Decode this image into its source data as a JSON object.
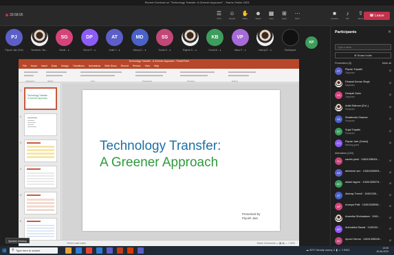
{
  "teams": {
    "window_title": "Recent Overload on \"Technology Transfer: A Greener Approach\" - Teams Online 2023",
    "timer": "33:58:05",
    "tools": [
      {
        "icon": "chat-icon",
        "glyph": "☰",
        "label": "Chat"
      },
      {
        "icon": "people-icon",
        "glyph": "☺",
        "label": "People"
      },
      {
        "icon": "raise-hand-icon",
        "glyph": "✋",
        "label": "Raise"
      },
      {
        "icon": "react-icon",
        "glyph": "☻",
        "label": "React"
      },
      {
        "icon": "view-icon",
        "glyph": "▦",
        "label": "View"
      },
      {
        "icon": "apps-icon",
        "glyph": "⊞",
        "label": "Apps"
      },
      {
        "icon": "more-icon",
        "glyph": "⋯",
        "label": "More"
      }
    ],
    "controls": [
      {
        "icon": "camera-icon",
        "glyph": "■",
        "label": "Camera"
      },
      {
        "icon": "mic-icon",
        "glyph": "♪",
        "label": "Mic"
      },
      {
        "icon": "share-icon",
        "glyph": "⇪",
        "label": "Share"
      }
    ],
    "leave_label": "Leave"
  },
  "participants_strip": [
    {
      "initials": "PJ",
      "name": "Piyush Jain (Ext)",
      "color": "#5b5fc7"
    },
    {
      "initials": "",
      "name": "Yeshveer, Ma...",
      "color": "#e8e8e8",
      "photo": true
    },
    {
      "initials": "SG",
      "name": "Sumit... ♦",
      "color": "#d6437a"
    },
    {
      "initials": "DP",
      "name": "Dhruv P... ♦",
      "color": "#8b5cf6"
    },
    {
      "initials": "AT",
      "name": "Ankit T... ♦",
      "color": "#5b5fc7"
    },
    {
      "initials": "MD",
      "name": "Manoj D... ♦",
      "color": "#4a62c9"
    },
    {
      "initials": "SS",
      "name": "Sonia S... ♦",
      "color": "#c24778"
    },
    {
      "initials": "",
      "name": "Rajesh K... ♦",
      "color": "#e8e8e8",
      "photo": true
    },
    {
      "initials": "KB",
      "name": "Kunal B... ♦",
      "color": "#3c9d5d"
    },
    {
      "initials": "VP",
      "name": "Vikas P... ♦",
      "color": "#a66bd6"
    },
    {
      "initials": "",
      "name": "Neeraj P... ♦",
      "color": "#e8e8e8",
      "photo": true
    },
    {
      "initials": "",
      "name": "Participant",
      "color": "#111111",
      "dark": true
    }
  ],
  "side_tile": {
    "initials": "KP",
    "color": "#3c9d5d"
  },
  "powerpoint": {
    "title": "Technology Transfer - A Greener Approach - PowerPoint",
    "tabs": [
      "File",
      "Home",
      "Insert",
      "Draw",
      "Design",
      "Transitions",
      "Animations",
      "Slide Show",
      "Record",
      "Review",
      "View",
      "Help"
    ],
    "ribbon_groups": [
      "Clipboard",
      "Slides",
      "Font",
      "Paragraph",
      "Drawing",
      "Editing"
    ],
    "thumb_title_l1": "Technology Transfer:",
    "thumb_title_l2": "A Greener Approach",
    "slide_title_l1": "Technology Transfer:",
    "slide_title_l2": "A Greener Approach",
    "presented_by": "Presented by",
    "presenter": "Piyush Jain",
    "status_left": "Click to add notes",
    "status_right": "Notes   Comments   ▭ ▦ ▤   — + 62%"
  },
  "panel": {
    "title": "Participants",
    "search_placeholder": "Type a name",
    "share_label": "Share invite",
    "presenters_label": "Presenters (8)",
    "mute_all": "Mute all",
    "attendees_label": "Attendees (120)",
    "presenters": [
      {
        "initials": "PT",
        "name": "Piyush Tripathi",
        "role": "Organizer",
        "color": "#5b5fc7"
      },
      {
        "initials": "",
        "name": "Dhawal Kumar Singh",
        "role": "Organizer",
        "color": "#e8e8e8",
        "photo": true
      },
      {
        "initials": "DS",
        "name": "Deepak Sahu",
        "role": "Organizer",
        "color": "#d6437a"
      },
      {
        "initials": "",
        "name": "Ankit Rathore (Ext..)",
        "role": "Presenter",
        "color": "#e8e8e8",
        "photo": true
      },
      {
        "initials": "SS",
        "name": "Shailendra Sharma",
        "role": "Presenter",
        "color": "#4a62c9"
      },
      {
        "initials": "ST",
        "name": "Sujal Tripathi",
        "role": "Presenter",
        "color": "#3c9d5d"
      },
      {
        "initials": "PJ",
        "name": "Piyush Jain (Guest)",
        "role": "Meeting guest",
        "color": "#8b5cf6"
      }
    ],
    "attendees": [
      {
        "initials": "SJ",
        "name": "sachin joshi · 1345132B001...",
        "color": "#c24778"
      },
      {
        "initials": "AS",
        "name": "abhishek sen · 1345132B003...",
        "color": "#5b5fc7"
      },
      {
        "initials": "AG",
        "name": "akash tagore · 1345132B078...",
        "color": "#3c9d5d"
      },
      {
        "initials": "AT",
        "name": "Akshay Trivedi · 13451326...",
        "color": "#4a62c9"
      },
      {
        "initials": "AP",
        "name": "Ananya Patil · 1345132B056...",
        "color": "#d6437a"
      },
      {
        "initials": "",
        "name": "Anamika Shrivastava · 1345...",
        "color": "#e8e8e8",
        "photo": true
      },
      {
        "initials": "AR",
        "name": "Aniruddha Rawat · 1345132...",
        "color": "#8b5cf6"
      },
      {
        "initials": "AV",
        "name": "Apurvi Verma · 1345132B045...",
        "color": "#c24778"
      }
    ]
  },
  "taskbar": {
    "search_placeholder": "Type here to search",
    "tray": "☁ 30°C  Mostly sunny  ∧ ▮ ☼ ◊ ENG",
    "time": "13:05",
    "date": "15-06-2023",
    "tooltip": "Speaker Desktop"
  }
}
